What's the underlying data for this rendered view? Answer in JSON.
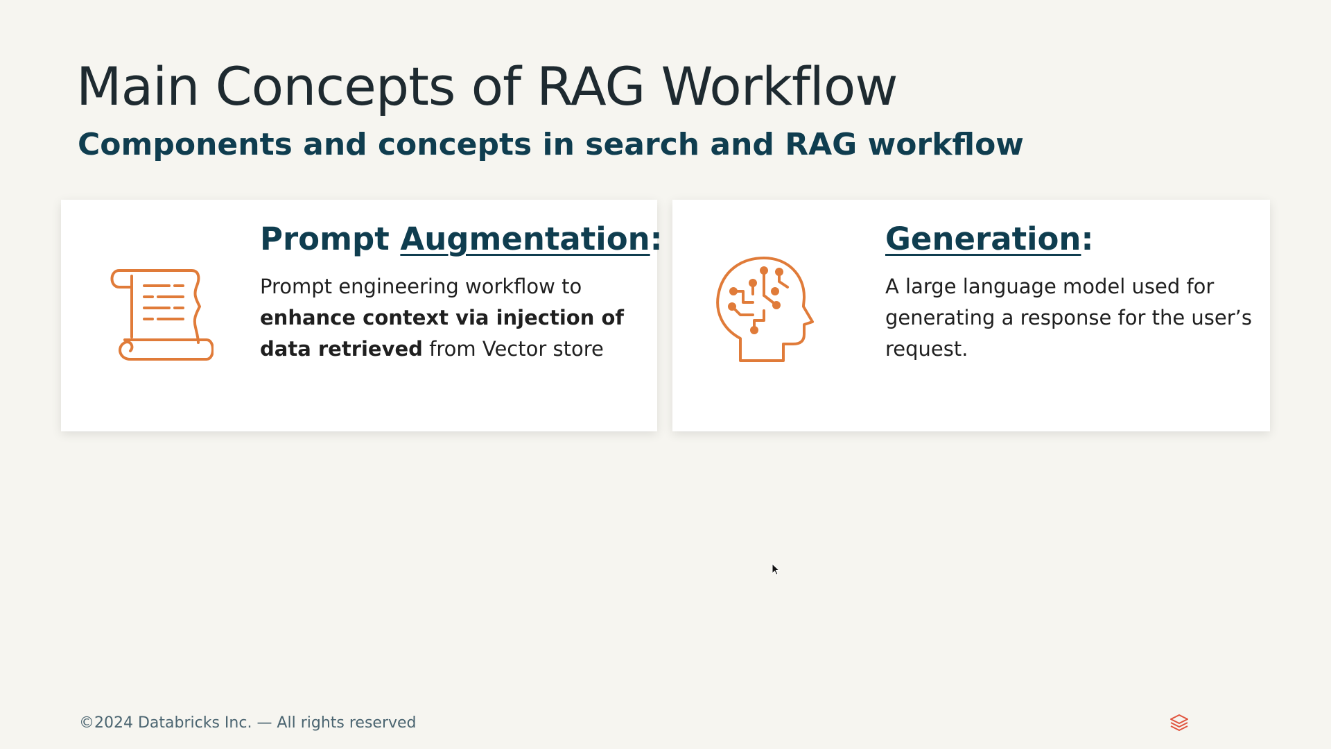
{
  "slide": {
    "title": "Main Concepts of RAG Workflow",
    "subtitle": "Components and concepts in search and RAG workflow"
  },
  "cards": [
    {
      "heading_prefix": "Prompt ",
      "heading_term": "Augmentation",
      "heading_suffix": ":",
      "body_plain_1": "Prompt engineering workflow to ",
      "body_bold": "enhance context via injection of data retrieved",
      "body_plain_2": " from Vector store",
      "icon": "scroll-document-icon"
    },
    {
      "heading_term": "Generation",
      "heading_suffix": ":",
      "body": "A large language model used for generating a response for the user’s request.",
      "icon": "brain-circuit-head-icon"
    }
  ],
  "footer": {
    "copyright": "©2024 Databricks Inc. — All rights reserved",
    "logo": "databricks-logo-icon"
  },
  "colors": {
    "background": "#f6f5f0",
    "title": "#1e2a30",
    "heading": "#0f3d4f",
    "accent_icon": "#e07b39",
    "logo": "#e0533e"
  }
}
